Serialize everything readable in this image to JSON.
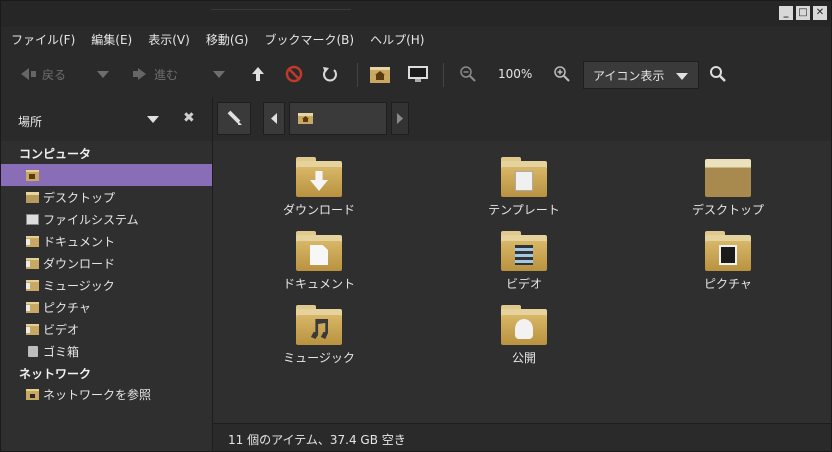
{
  "window": {
    "controls": [
      "_",
      "□",
      "✕"
    ]
  },
  "menu": [
    "ファイル(F)",
    "編集(E)",
    "表示(V)",
    "移動(G)",
    "ブックマーク(B)",
    "ヘルプ(H)"
  ],
  "toolbar": {
    "back": "戻る",
    "forward": "進む",
    "zoom": "100%",
    "view_mode": "アイコン表示"
  },
  "sidebar": {
    "title": "場所",
    "close": "✖",
    "sections": [
      {
        "label": "コンピュータ",
        "items": [
          {
            "label": "",
            "icon": "home-folder-icon",
            "active": true
          },
          {
            "label": "デスクトップ",
            "icon": "desktop-icon"
          },
          {
            "label": "ファイルシステム",
            "icon": "filesystem-icon"
          },
          {
            "label": "ドキュメント",
            "icon": "documents-folder-icon"
          },
          {
            "label": "ダウンロード",
            "icon": "downloads-folder-icon"
          },
          {
            "label": "ミュージック",
            "icon": "music-folder-icon"
          },
          {
            "label": "ピクチャ",
            "icon": "pictures-folder-icon"
          },
          {
            "label": "ビデオ",
            "icon": "videos-folder-icon"
          },
          {
            "label": "ゴミ箱",
            "icon": "trash-icon"
          }
        ]
      },
      {
        "label": "ネットワーク",
        "items": [
          {
            "label": "ネットワークを参照",
            "icon": "network-folder-icon"
          }
        ]
      }
    ]
  },
  "files": [
    {
      "name": "ダウンロード",
      "icon": "downloads-folder-icon"
    },
    {
      "name": "テンプレート",
      "icon": "templates-folder-icon"
    },
    {
      "name": "デスクトップ",
      "icon": "desktop-folder-icon"
    },
    {
      "name": "ドキュメント",
      "icon": "documents-folder-icon"
    },
    {
      "name": "ビデオ",
      "icon": "videos-folder-icon"
    },
    {
      "name": "ピクチャ",
      "icon": "pictures-folder-icon"
    },
    {
      "name": "ミュージック",
      "icon": "music-folder-icon"
    },
    {
      "name": "公開",
      "icon": "public-folder-icon"
    }
  ],
  "status": "11 個のアイテム、37.4 GB 空き",
  "colors": {
    "accent": "#8a6db7",
    "folder": "#c8a862",
    "background": "#2f2f2f"
  }
}
